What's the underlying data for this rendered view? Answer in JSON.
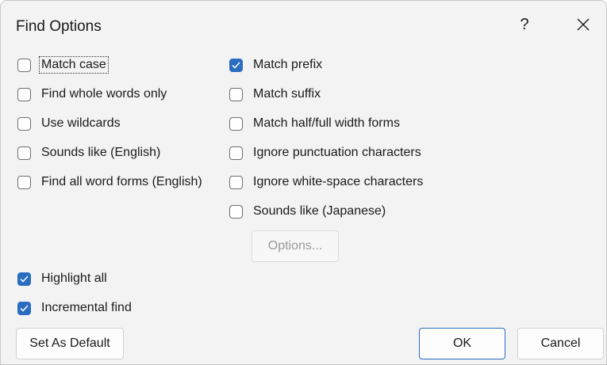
{
  "dialog": {
    "title": "Find Options",
    "help_label": "?"
  },
  "left_options": [
    {
      "label": "Match case",
      "checked": false
    },
    {
      "label": "Find whole words only",
      "checked": false
    },
    {
      "label": "Use wildcards",
      "checked": false
    },
    {
      "label": "Sounds like (English)",
      "checked": false
    },
    {
      "label": "Find all word forms (English)",
      "checked": false
    }
  ],
  "right_options": [
    {
      "label": "Match prefix",
      "checked": true
    },
    {
      "label": "Match suffix",
      "checked": false
    },
    {
      "label": "Match half/full width forms",
      "checked": false
    },
    {
      "label": "Ignore punctuation characters",
      "checked": false
    },
    {
      "label": "Ignore white-space characters",
      "checked": false
    },
    {
      "label": "Sounds like (Japanese)",
      "checked": false
    }
  ],
  "options_button": {
    "label": "Options...",
    "enabled": false
  },
  "bottom_options": [
    {
      "label": "Highlight all",
      "checked": true
    },
    {
      "label": "Incremental find",
      "checked": true
    }
  ],
  "buttons": {
    "set_default": "Set As Default",
    "ok": "OK",
    "cancel": "Cancel"
  },
  "colors": {
    "accent": "#2a6dc0",
    "dialog_bg": "#f3f3f3"
  }
}
